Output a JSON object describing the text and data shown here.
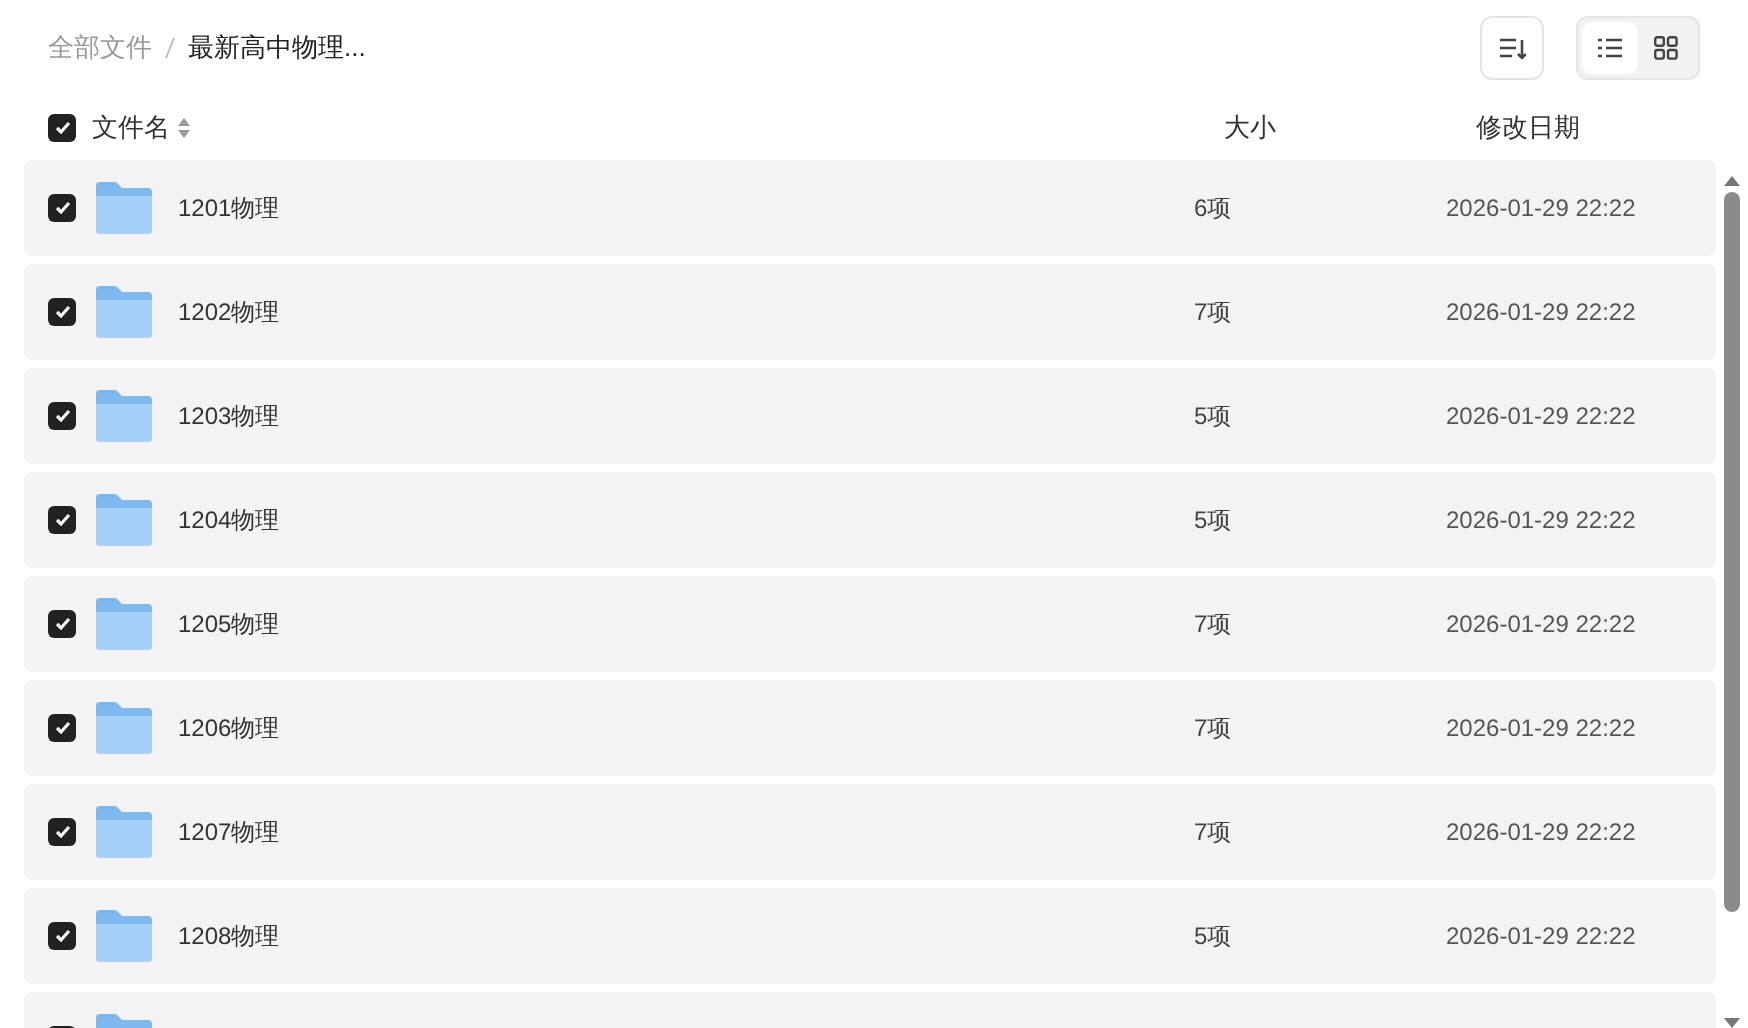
{
  "breadcrumb": [
    {
      "label": "全部文件",
      "current": false
    },
    {
      "label": "最新高中物理...",
      "current": true
    }
  ],
  "toolbar": {
    "views": [
      {
        "kind": "list",
        "selected": true
      },
      {
        "kind": "grid",
        "selected": false
      }
    ]
  },
  "header": {
    "all_checked": true,
    "columns": [
      {
        "label": "文件名",
        "sortable": true
      },
      {
        "label": "大小",
        "sortable": false
      },
      {
        "label": "修改日期",
        "sortable": false
      }
    ]
  },
  "rows": [
    {
      "name": "1201物理",
      "size": "6项",
      "modified": "2026-01-29 22:22",
      "checked": true
    },
    {
      "name": "1202物理",
      "size": "7项",
      "modified": "2026-01-29 22:22",
      "checked": true
    },
    {
      "name": "1203物理",
      "size": "5项",
      "modified": "2026-01-29 22:22",
      "checked": true
    },
    {
      "name": "1204物理",
      "size": "5项",
      "modified": "2026-01-29 22:22",
      "checked": true
    },
    {
      "name": "1205物理",
      "size": "7项",
      "modified": "2026-01-29 22:22",
      "checked": true
    },
    {
      "name": "1206物理",
      "size": "7项",
      "modified": "2026-01-29 22:22",
      "checked": true
    },
    {
      "name": "1207物理",
      "size": "7项",
      "modified": "2026-01-29 22:22",
      "checked": true
    },
    {
      "name": "1208物理",
      "size": "5项",
      "modified": "2026-01-29 22:22",
      "checked": true
    },
    {
      "checked": true
    }
  ]
}
